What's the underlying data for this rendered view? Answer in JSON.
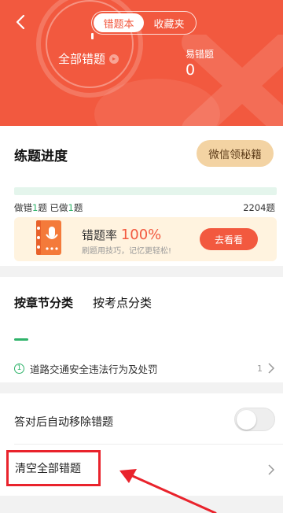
{
  "header": {
    "tabs": [
      {
        "label": "错题本",
        "active": true
      },
      {
        "label": "收藏夹",
        "active": false
      }
    ],
    "all_wrong_label": "全部错题",
    "easy_wrong_label": "易错题",
    "easy_wrong_value": "0"
  },
  "progress": {
    "title": "练题进度",
    "wechat_button": "微信领秘籍",
    "wrong_prefix": "做错",
    "wrong_count": "1",
    "wrong_unit": "题",
    "done_prefix": "已做",
    "done_count": "1",
    "done_unit": "题",
    "total": "2204题",
    "promo": {
      "rate_label": "错题率",
      "rate_value": "100%",
      "tip": "刷题用技巧，记忆更轻松!",
      "button": "去看看"
    }
  },
  "categories": {
    "tabs": [
      {
        "label": "按章节分类",
        "active": true
      },
      {
        "label": "按考点分类",
        "active": false
      }
    ],
    "items": [
      {
        "index": "1",
        "title": "道路交通安全违法行为及处罚",
        "count": "1"
      }
    ]
  },
  "settings": {
    "auto_remove_label": "答对后自动移除错题",
    "auto_remove_on": false,
    "clear_all_label": "清空全部错题"
  },
  "colors": {
    "brand": "#f2593f",
    "green": "#2fb36a",
    "gold": "#f3d3a3",
    "annotation_red": "#e9232c"
  },
  "icons": {
    "back": "chevron-left-icon",
    "info": "info-icon",
    "book": "wrong-book-icon",
    "chevron": "chevron-right-icon"
  }
}
